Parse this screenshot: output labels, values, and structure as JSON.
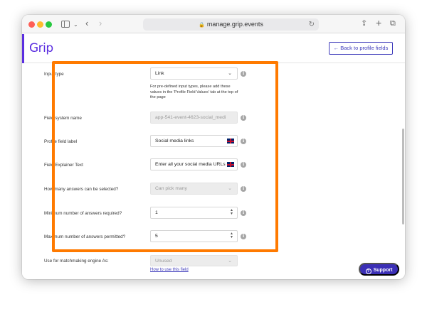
{
  "browser": {
    "url": "manage.grip.events"
  },
  "header": {
    "logo": "Grip",
    "back_button": "← Back to profile fields"
  },
  "form": {
    "input_type": {
      "label": "Input type",
      "value": "Link"
    },
    "help_text": "For pre-defined input types, please add these values in the 'Profile Field Values' tab at the top of the page",
    "field_system_name": {
      "label": "Field system name",
      "value": "app-541-event-4623-social_medi"
    },
    "profile_field_label": {
      "label": "Profile field label",
      "value": "Social media links"
    },
    "field_explainer_text": {
      "label": "Field Explainer Text",
      "value": "Enter all your social media URLs i"
    },
    "answers_selectable": {
      "label": "How many answers can be selected?",
      "value": "Can pick many"
    },
    "min_answers": {
      "label": "Minimum number of answers required?",
      "value": "1"
    },
    "max_answers": {
      "label": "Maximum number of answers permitted?",
      "value": "5"
    },
    "matchmaking": {
      "label": "Use for matchmaking engine As:",
      "value": "Unused",
      "help_link": "How to use this field"
    }
  },
  "support": {
    "label": "Support"
  },
  "colors": {
    "brand": "#5b2ee0",
    "highlight": "#ff7a00",
    "support_bg": "#3b2fb6"
  }
}
